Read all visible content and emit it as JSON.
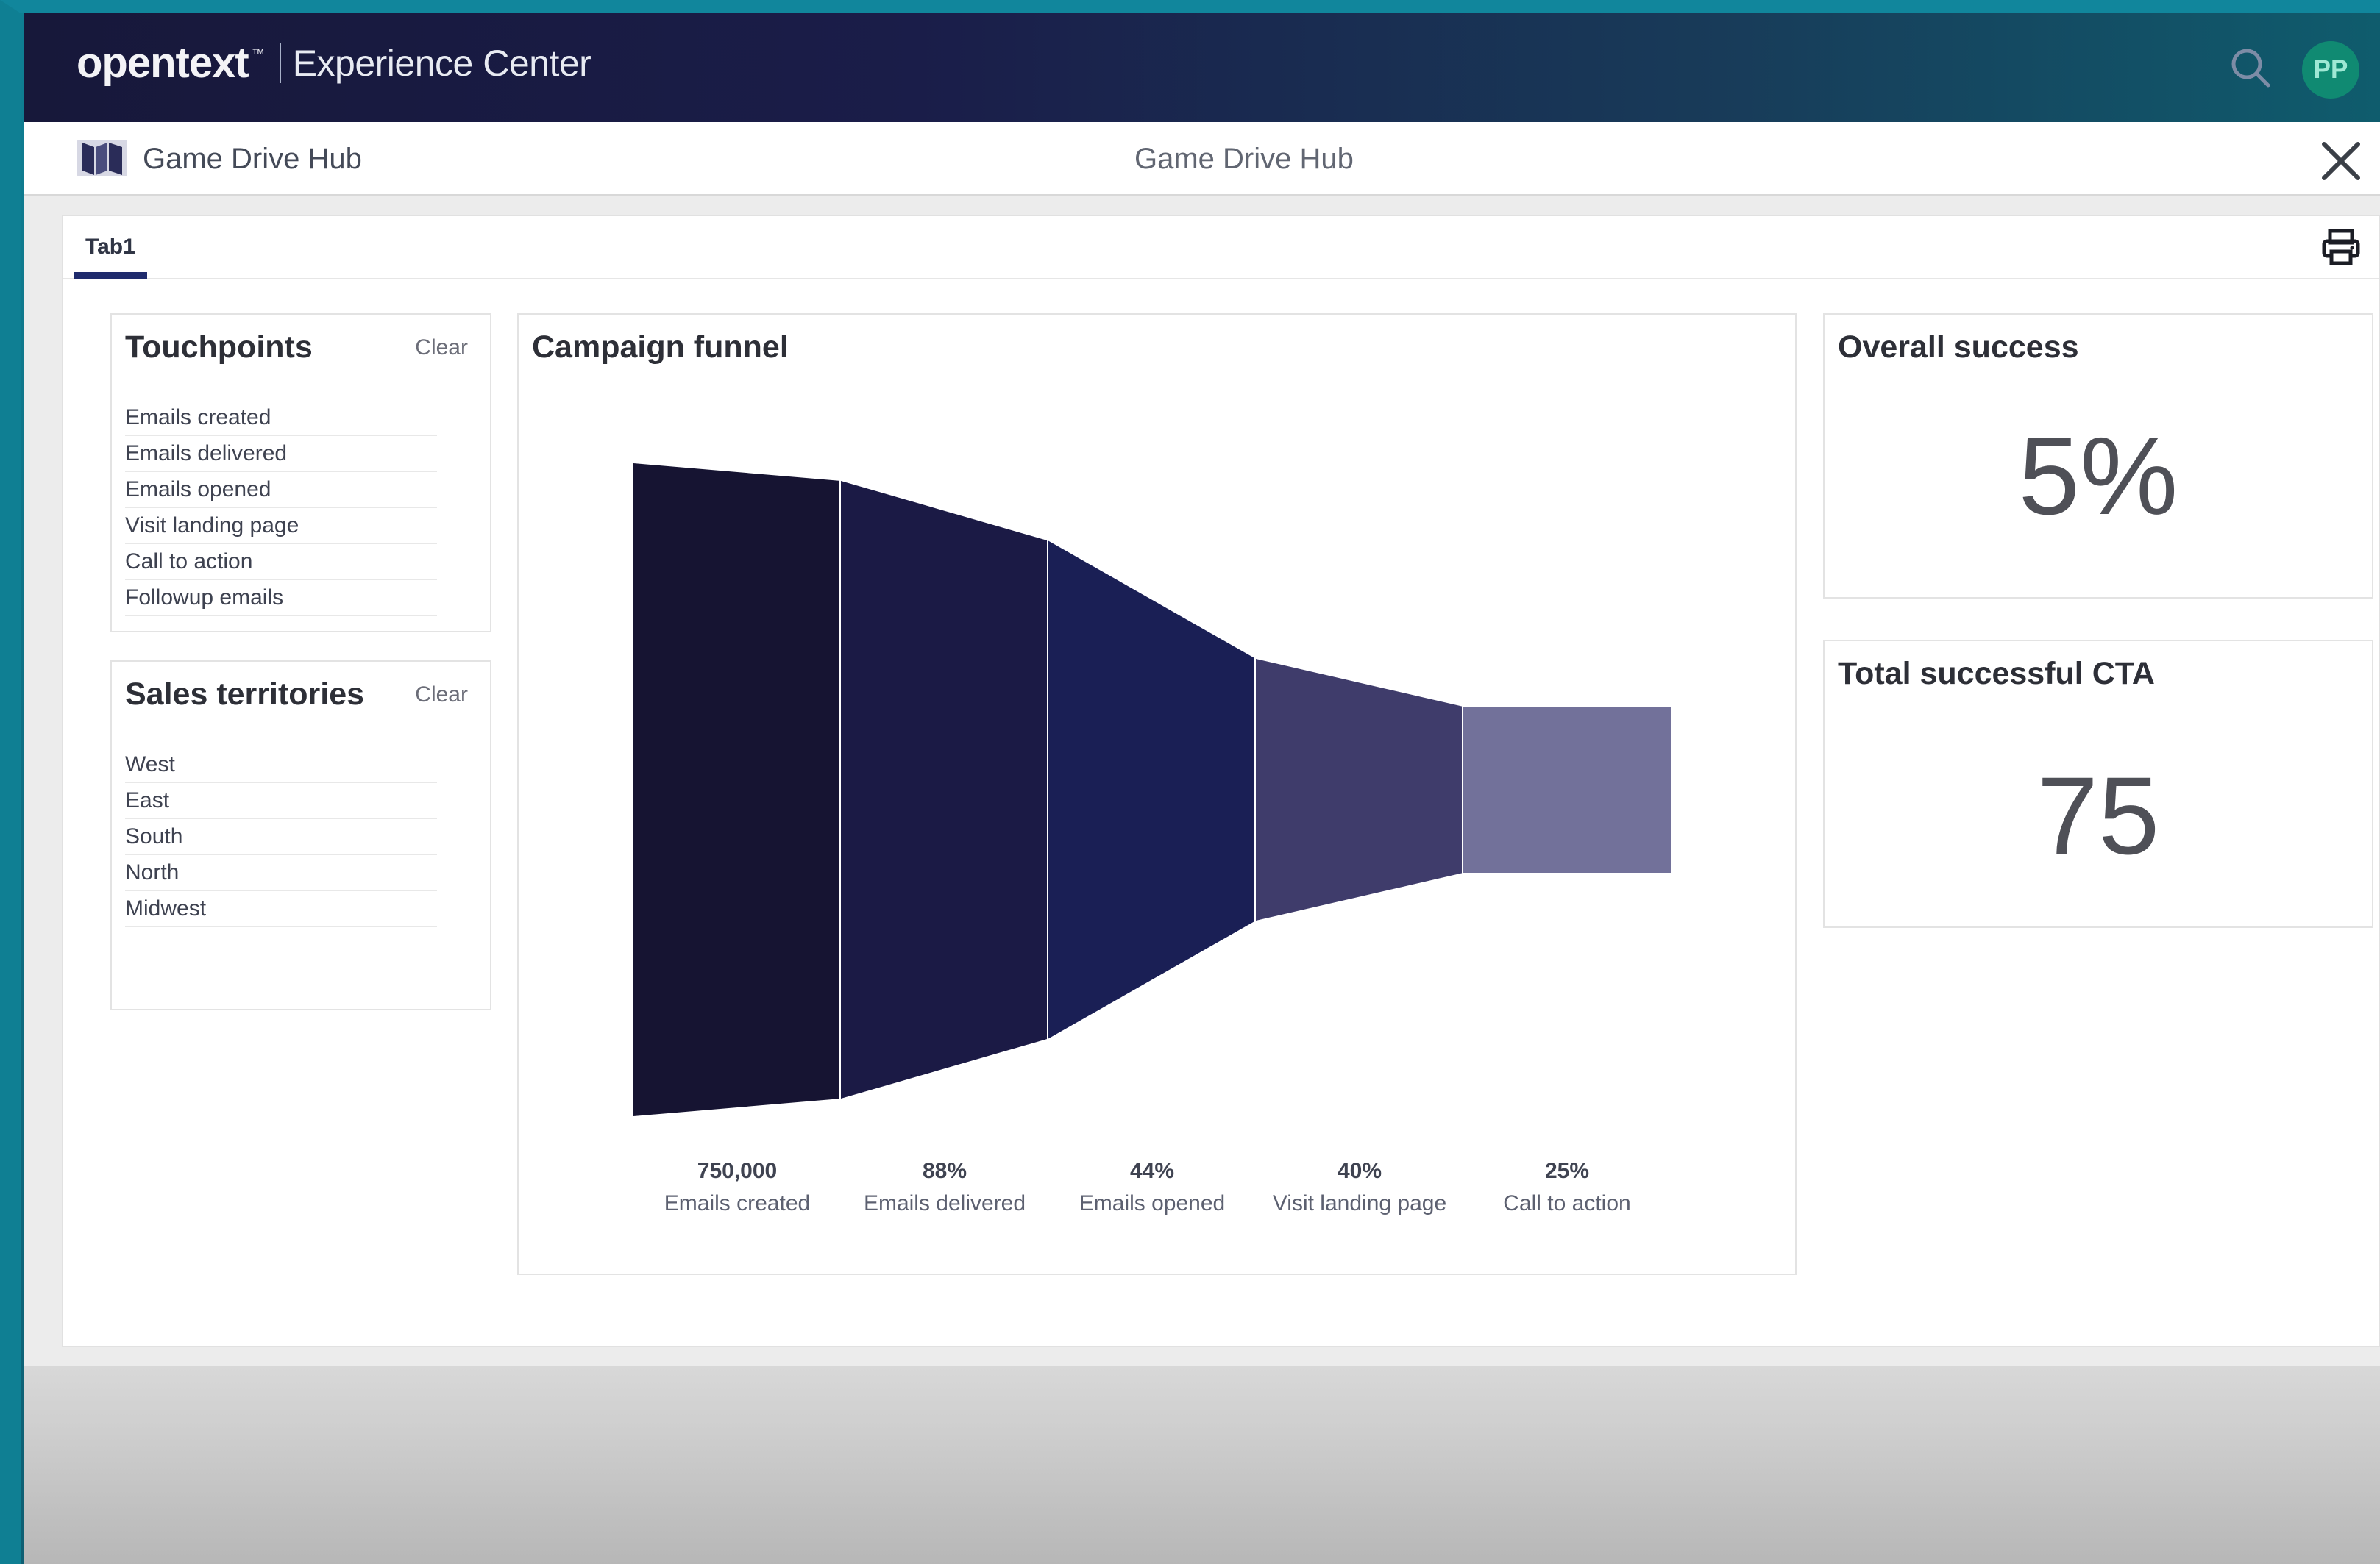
{
  "header": {
    "brand": "opentext",
    "brand_tm": "™",
    "product": "Experience Center",
    "avatar_initials": "PP",
    "search_icon": "search-icon"
  },
  "hub": {
    "left_title": "Game Drive Hub",
    "center_title": "Game Drive Hub",
    "icon": "book-map-icon",
    "close_icon": "close-icon"
  },
  "tabs": [
    {
      "label": "Tab1"
    }
  ],
  "toolbar": {
    "print_icon": "print-icon"
  },
  "touchpoints": {
    "title": "Touchpoints",
    "clear_label": "Clear",
    "items": [
      "Emails created",
      "Emails delivered",
      "Emails opened",
      "Visit landing page",
      "Call to action",
      "Followup emails"
    ]
  },
  "sales_territories": {
    "title": "Sales territories",
    "clear_label": "Clear",
    "items": [
      "West",
      "East",
      "South",
      "North",
      "Midwest"
    ]
  },
  "campaign_funnel": {
    "title": "Campaign funnel"
  },
  "chart_data": {
    "type": "funnel",
    "title": "Campaign funnel",
    "stages": [
      {
        "label": "750,000",
        "name": "Emails created",
        "value": 1.0,
        "color": "#161432"
      },
      {
        "label": "88%",
        "name": "Emails delivered",
        "value": 0.88,
        "color": "#1b1a45"
      },
      {
        "label": "44%",
        "name": "Emails opened",
        "value": 0.44,
        "color": "#1a1f55"
      },
      {
        "label": "40%",
        "name": "Visit landing page",
        "value": 0.4,
        "color": "#3f3c6b"
      },
      {
        "label": "25%",
        "name": "Call to action",
        "value": 0.25,
        "color": "#72719a"
      }
    ]
  },
  "overall_success": {
    "title": "Overall success",
    "value": "5%"
  },
  "total_successful_cta": {
    "title": "Total successful CTA",
    "value": "75"
  },
  "colors": {
    "topbar_dark": "#17183a",
    "accent_tab": "#1f2b6d",
    "avatar_bg": "#108a72"
  }
}
